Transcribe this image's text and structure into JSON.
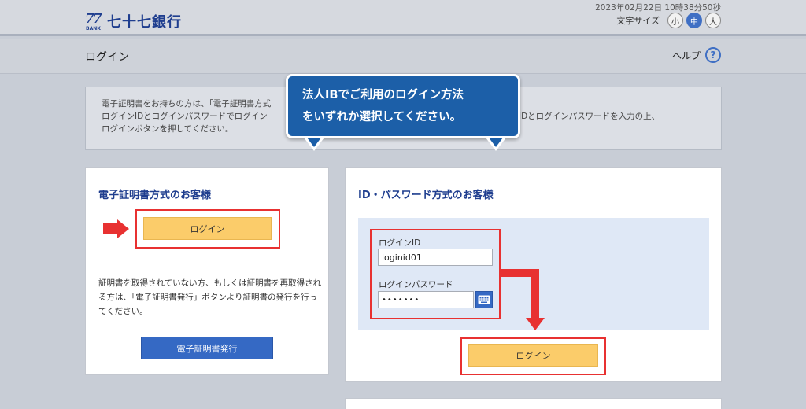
{
  "header": {
    "logo_number": "77",
    "logo_bank": "BANK",
    "bank_name": "七十七銀行",
    "datetime": "2023年02月22日 10時38分50秒",
    "font_size_label": "文字サイズ",
    "font_sizes": [
      "小",
      "中",
      "大"
    ],
    "font_size_active": "中"
  },
  "titlebar": {
    "title": "ログイン",
    "help_label": "ヘルプ",
    "help_icon": "?"
  },
  "info": {
    "lines": [
      "電子証明書をお持ちの方は、「電子証明書方式",
      "ログインIDとログインパスワードでログイン",
      "ログインボタンを押してください。"
    ],
    "right_line": "IDとログインパスワードを入力の上、"
  },
  "callout": {
    "line1": "法人IBでご利用のログイン方法",
    "line2": "をいずれか選択してください。"
  },
  "cert_panel": {
    "title": "電子証明書方式のお客様",
    "login_button": "ログイン",
    "note": "証明書を取得されていない方、もしくは証明書を再取得される方は、「電子証明書発行」ボタンより証明書の発行を行ってください。",
    "issue_button": "電子証明書発行"
  },
  "id_panel": {
    "title": "ID・パスワード方式のお客様",
    "login_id_label": "ログインID",
    "login_id_value": "loginid01",
    "password_label": "ログインパスワード",
    "password_value": "•••••••",
    "login_button": "ログイン"
  },
  "colors": {
    "accent_blue": "#1f3e8f",
    "callout_blue": "#1c5fa8",
    "button_yellow": "#fbcc6a",
    "highlight_red": "#e83131"
  }
}
